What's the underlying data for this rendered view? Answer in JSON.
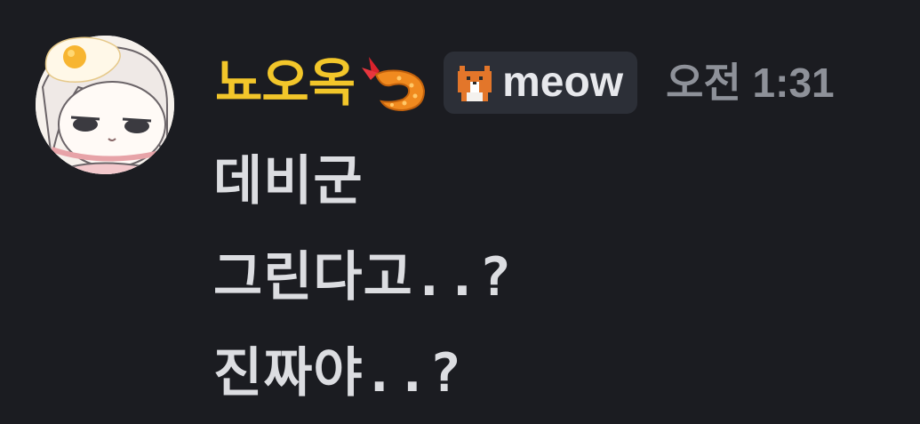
{
  "message": {
    "author": {
      "username": "뇨오옥",
      "avatar_icon": "egg-hat-anime-avatar",
      "name_color": "#f2c62a",
      "emoji_icon": "fried-shrimp-icon"
    },
    "tag": {
      "icon": "pixel-cat-icon",
      "label": "meow"
    },
    "timestamp": "오전 1:31",
    "lines": [
      "데비군",
      "그린다고..?",
      "진짜야..?"
    ]
  }
}
